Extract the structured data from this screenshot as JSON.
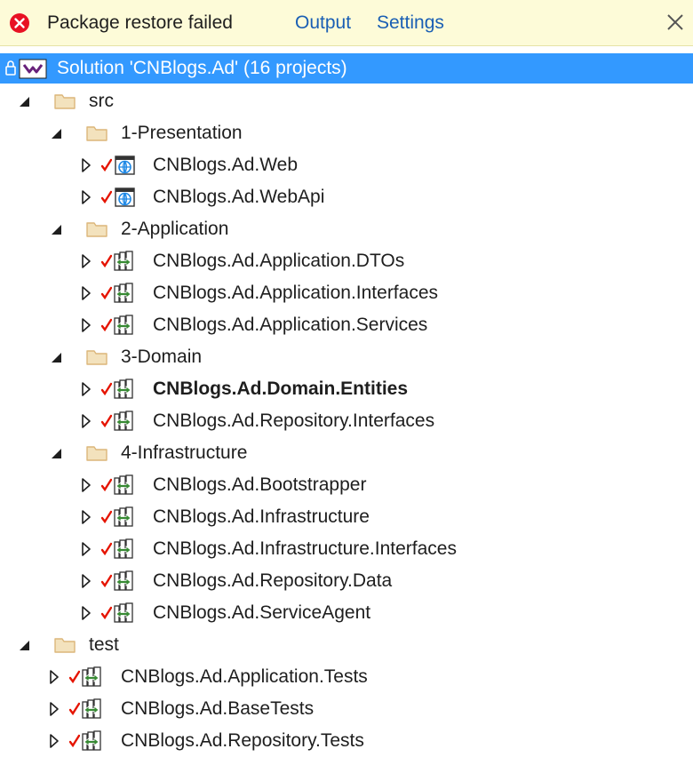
{
  "infobar": {
    "message": "Package restore failed",
    "output_link": "Output",
    "settings_link": "Settings"
  },
  "solution": {
    "label": "Solution 'CNBlogs.Ad' (16 projects)"
  },
  "colors": {
    "selection": "#3399ff",
    "infobar_bg": "#fdfbd8",
    "link": "#1a5fb4",
    "error": "#e81123",
    "check": "#e51400",
    "folder": "#dcb67a"
  },
  "tree": [
    {
      "label": "src",
      "kind": "folder",
      "expanded": true
    },
    {
      "label": "1-Presentation",
      "kind": "folder",
      "expanded": true
    },
    {
      "label": "CNBlogs.Ad.Web",
      "kind": "web-project",
      "expanded": false
    },
    {
      "label": "CNBlogs.Ad.WebApi",
      "kind": "web-project",
      "expanded": false
    },
    {
      "label": "2-Application",
      "kind": "folder",
      "expanded": true
    },
    {
      "label": "CNBlogs.Ad.Application.DTOs",
      "kind": "library-project",
      "expanded": false
    },
    {
      "label": "CNBlogs.Ad.Application.Interfaces",
      "kind": "library-project",
      "expanded": false
    },
    {
      "label": "CNBlogs.Ad.Application.Services",
      "kind": "library-project",
      "expanded": false
    },
    {
      "label": "3-Domain",
      "kind": "folder",
      "expanded": true
    },
    {
      "label": "CNBlogs.Ad.Domain.Entities",
      "kind": "library-project",
      "expanded": false,
      "bold": true
    },
    {
      "label": "CNBlogs.Ad.Repository.Interfaces",
      "kind": "library-project",
      "expanded": false
    },
    {
      "label": "4-Infrastructure",
      "kind": "folder",
      "expanded": true
    },
    {
      "label": "CNBlogs.Ad.Bootstrapper",
      "kind": "library-project",
      "expanded": false
    },
    {
      "label": "CNBlogs.Ad.Infrastructure",
      "kind": "library-project",
      "expanded": false
    },
    {
      "label": "CNBlogs.Ad.Infrastructure.Interfaces",
      "kind": "library-project",
      "expanded": false
    },
    {
      "label": "CNBlogs.Ad.Repository.Data",
      "kind": "library-project",
      "expanded": false
    },
    {
      "label": "CNBlogs.Ad.ServiceAgent",
      "kind": "library-project",
      "expanded": false
    },
    {
      "label": "test",
      "kind": "folder",
      "expanded": true
    },
    {
      "label": "CNBlogs.Ad.Application.Tests",
      "kind": "library-project",
      "expanded": false
    },
    {
      "label": "CNBlogs.Ad.BaseTests",
      "kind": "library-project",
      "expanded": false
    },
    {
      "label": "CNBlogs.Ad.Repository.Tests",
      "kind": "library-project",
      "expanded": false
    }
  ]
}
